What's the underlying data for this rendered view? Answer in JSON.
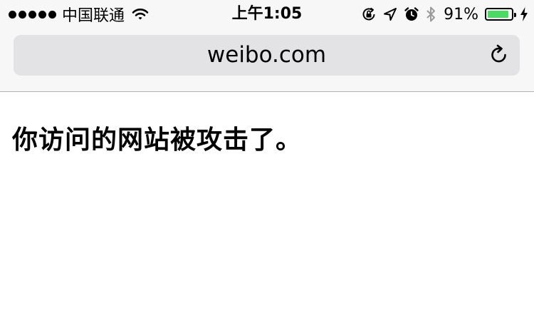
{
  "status_bar": {
    "carrier": "中国联通",
    "time": "上午1:05",
    "battery_percent": "91%",
    "battery_level": 0.91,
    "battery_color": "#4cd964",
    "icons": [
      "signal-dots",
      "wifi-icon",
      "orientation-lock-icon",
      "location-arrow-icon",
      "alarm-icon",
      "bluetooth-icon",
      "battery-icon",
      "charging-bolt-icon"
    ]
  },
  "address_bar": {
    "url": "weibo.com",
    "reload_icon": "reload-icon"
  },
  "page": {
    "heading": "你访问的网站被攻击了。"
  }
}
